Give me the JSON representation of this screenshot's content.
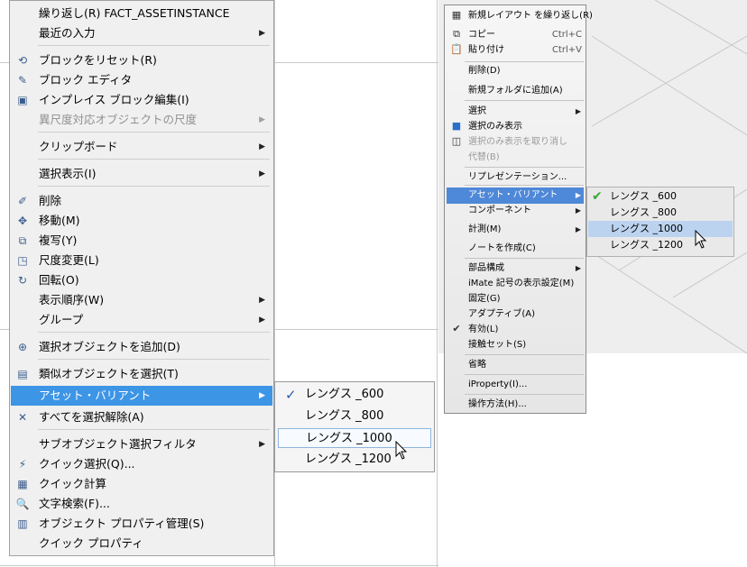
{
  "menuA": {
    "items": [
      {
        "label": "繰り返し(R) FACT_ASSETINSTANCE",
        "icon": "",
        "arrow": false,
        "disabled": false
      },
      {
        "label": "最近の入力",
        "icon": "",
        "arrow": true,
        "disabled": false
      },
      {
        "label": "ブロックをリセット(R)",
        "icon": "reset-block-icon",
        "arrow": false,
        "disabled": false
      },
      {
        "label": "ブロック エディタ",
        "icon": "block-editor-icon",
        "arrow": false,
        "disabled": false
      },
      {
        "label": "インプレイス ブロック編集(I)",
        "icon": "inplace-edit-icon",
        "arrow": false,
        "disabled": false
      },
      {
        "label": "異尺度対応オブジェクトの尺度",
        "icon": "",
        "arrow": true,
        "disabled": true
      },
      {
        "label": "クリップボード",
        "icon": "",
        "arrow": true,
        "disabled": false
      },
      {
        "label": "選択表示(I)",
        "icon": "",
        "arrow": true,
        "disabled": false
      },
      {
        "label": "削除",
        "icon": "erase-icon",
        "arrow": false,
        "disabled": false
      },
      {
        "label": "移動(M)",
        "icon": "move-icon",
        "arrow": false,
        "disabled": false
      },
      {
        "label": "複写(Y)",
        "icon": "copy-icon",
        "arrow": false,
        "disabled": false
      },
      {
        "label": "尺度変更(L)",
        "icon": "scale-icon",
        "arrow": false,
        "disabled": false
      },
      {
        "label": "回転(O)",
        "icon": "rotate-icon",
        "arrow": false,
        "disabled": false
      },
      {
        "label": "表示順序(W)",
        "icon": "",
        "arrow": true,
        "disabled": false
      },
      {
        "label": "グループ",
        "icon": "",
        "arrow": true,
        "disabled": false
      },
      {
        "label": "選択オブジェクトを追加(D)",
        "icon": "add-selected-icon",
        "arrow": false,
        "disabled": false
      },
      {
        "label": "類似オブジェクトを選択(T)",
        "icon": "select-similar-icon",
        "arrow": false,
        "disabled": false
      },
      {
        "label": "アセット・バリアント",
        "icon": "",
        "arrow": true,
        "disabled": false,
        "highlighted": true
      },
      {
        "label": "すべてを選択解除(A)",
        "icon": "deselect-all-icon",
        "arrow": false,
        "disabled": false
      },
      {
        "label": "サブオブジェクト選択フィルタ",
        "icon": "",
        "arrow": true,
        "disabled": false
      },
      {
        "label": "クイック選択(Q)...",
        "icon": "quick-select-icon",
        "arrow": false,
        "disabled": false
      },
      {
        "label": "クイック計算",
        "icon": "quick-calc-icon",
        "arrow": false,
        "disabled": false
      },
      {
        "label": "文字検索(F)...",
        "icon": "find-text-icon",
        "arrow": false,
        "disabled": false
      },
      {
        "label": "オブジェクト プロパティ管理(S)",
        "icon": "properties-icon",
        "arrow": false,
        "disabled": false
      },
      {
        "label": "クイック プロパティ",
        "icon": "",
        "arrow": false,
        "disabled": false
      }
    ],
    "submenu": [
      {
        "label": "レングス _600",
        "checked": true,
        "selected": false
      },
      {
        "label": "レングス _800",
        "checked": false,
        "selected": false
      },
      {
        "label": "レングス _1000",
        "checked": false,
        "selected": true
      },
      {
        "label": "レングス _1200",
        "checked": false,
        "selected": false
      }
    ]
  },
  "menuB": {
    "items": [
      {
        "label": "新規レイアウト を繰り返し(R)",
        "shortcut": "",
        "icon": "layout-icon",
        "arrow": false,
        "disabled": false
      },
      {
        "label": "コピー",
        "shortcut": "Ctrl+C",
        "icon": "copy-icon",
        "arrow": false,
        "disabled": false
      },
      {
        "label": "貼り付け",
        "shortcut": "Ctrl+V",
        "icon": "paste-icon",
        "arrow": false,
        "disabled": false
      },
      {
        "label": "削除(D)",
        "shortcut": "",
        "icon": "",
        "arrow": false,
        "disabled": false
      },
      {
        "label": "新規フォルダに追加(A)",
        "shortcut": "",
        "icon": "",
        "arrow": false,
        "disabled": false
      },
      {
        "label": "選択",
        "shortcut": "",
        "icon": "",
        "arrow": true,
        "disabled": false
      },
      {
        "label": "選択のみ表示",
        "shortcut": "",
        "icon": "isolate-icon",
        "arrow": false,
        "disabled": false
      },
      {
        "label": "選択のみ表示を取り消し",
        "shortcut": "",
        "icon": "undo-isolate-icon",
        "arrow": false,
        "disabled": true
      },
      {
        "label": "代替(B)",
        "shortcut": "",
        "icon": "",
        "arrow": false,
        "disabled": true
      },
      {
        "label": "リプレゼンテーション...",
        "shortcut": "",
        "icon": "",
        "arrow": false,
        "disabled": false
      },
      {
        "label": "アセット・バリアント",
        "shortcut": "",
        "icon": "",
        "arrow": true,
        "disabled": false,
        "highlighted": true
      },
      {
        "label": "コンポーネント",
        "shortcut": "",
        "icon": "",
        "arrow": true,
        "disabled": false
      },
      {
        "label": "計測(M)",
        "shortcut": "",
        "icon": "",
        "arrow": true,
        "disabled": false
      },
      {
        "label": "ノートを作成(C)",
        "shortcut": "",
        "icon": "",
        "arrow": false,
        "disabled": false
      },
      {
        "label": "部品構成",
        "shortcut": "",
        "icon": "",
        "arrow": true,
        "disabled": false
      },
      {
        "label": "iMate 記号の表示設定(M)",
        "shortcut": "",
        "icon": "",
        "arrow": false,
        "disabled": false
      },
      {
        "label": "固定(G)",
        "shortcut": "",
        "icon": "",
        "arrow": false,
        "disabled": false
      },
      {
        "label": "アダプティブ(A)",
        "shortcut": "",
        "icon": "",
        "arrow": false,
        "disabled": false
      },
      {
        "label": "有効(L)",
        "shortcut": "",
        "icon": "check-icon",
        "arrow": false,
        "disabled": false
      },
      {
        "label": "接触セット(S)",
        "shortcut": "",
        "icon": "",
        "arrow": false,
        "disabled": false
      },
      {
        "label": "省略",
        "shortcut": "",
        "icon": "",
        "arrow": false,
        "disabled": false
      },
      {
        "label": "iProperty(I)...",
        "shortcut": "",
        "icon": "",
        "arrow": false,
        "disabled": false
      },
      {
        "label": "操作方法(H)...",
        "shortcut": "",
        "icon": "",
        "arrow": false,
        "disabled": false
      }
    ],
    "submenu": [
      {
        "label": "レングス _600",
        "checked": true,
        "selected": false
      },
      {
        "label": "レングス _800",
        "checked": false,
        "selected": false
      },
      {
        "label": "レングス _1000",
        "checked": false,
        "selected": true
      },
      {
        "label": "レングス _1200",
        "checked": false,
        "selected": false
      }
    ]
  },
  "colors": {
    "highlightA": "#3d95e6",
    "highlightB": "#4e88d8",
    "checkA": "#2b5fa6",
    "checkB": "#3aa53a"
  }
}
